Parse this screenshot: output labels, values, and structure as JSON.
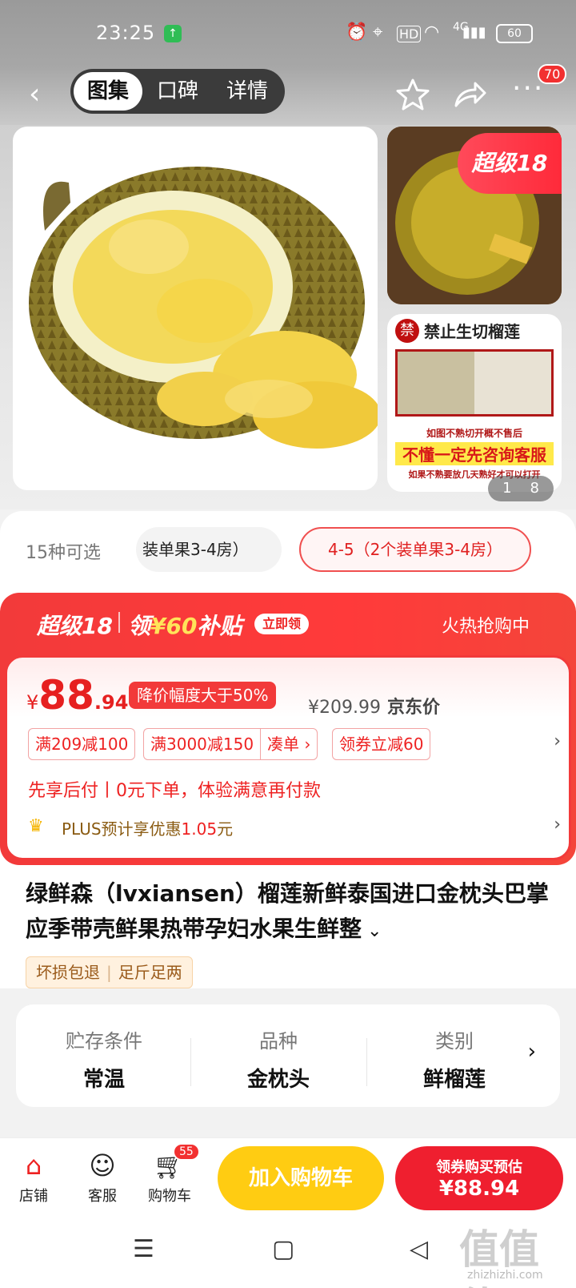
{
  "status_bar": {
    "time": "23:25",
    "network": "4G",
    "battery": "60"
  },
  "top_nav": {
    "tabs": [
      "图集",
      "口碑",
      "详情"
    ],
    "active_tab": "图集",
    "more_badge": "70"
  },
  "gallery": {
    "ribbon": "超级18",
    "counter_current": "1",
    "counter_total": "8",
    "banner_title": "禁止生切榴莲",
    "banner_mark": "禁",
    "banner_line1": "如图不熟切开概不售后",
    "banner_line2": "不懂一定先咨询客服",
    "banner_line3": "如果不熟要放几天熟好才可以打开"
  },
  "options": {
    "count_label": "15种可选",
    "chip_1": "装单果3-4房）",
    "chip_2": "4-5（2个装单果3-4房）"
  },
  "promo": {
    "brand": "超级18",
    "subsidy_prefix": "领",
    "subsidy_amount": "¥60",
    "subsidy_suffix": "补贴",
    "claim_btn": "立即领",
    "status": "火热抢购中"
  },
  "price": {
    "currency": "¥",
    "integer": "88",
    "decimal": ".94",
    "discount_tag": "降价幅度大于50%",
    "jd_price": "¥209.99",
    "jd_price_label": "京东价"
  },
  "coupons": [
    "满209减100",
    "满3000减150",
    "凑单 ›",
    "领券立减60"
  ],
  "pay_later": "先享后付丨0元下单，体验满意再付款",
  "plus": {
    "prefix": "PLUS预计享优惠",
    "value": "1.05",
    "suffix": "元"
  },
  "product": {
    "title": "绿鲜森（lvxiansen）榴莲新鲜泰国进口金枕头巴掌应季带壳鲜果热带孕妇水果生鲜整",
    "guarantee_1": "坏损包退",
    "guarantee_2": "足斤足两"
  },
  "specs": [
    {
      "key": "贮存条件",
      "value": "常温"
    },
    {
      "key": "品种",
      "value": "金枕头"
    },
    {
      "key": "类别",
      "value": "鲜榴莲"
    }
  ],
  "bottom_bar": {
    "shop": "店铺",
    "service": "客服",
    "cart": "购物车",
    "cart_badge": "55",
    "add_to_cart": "加入购物车",
    "buy_line1": "领券购买预估",
    "buy_line2": "¥88.94"
  },
  "watermark": {
    "text": "值",
    "site": "zhizhizhi.com"
  },
  "colors": {
    "accent": "#f23a3a",
    "cart_yellow": "#ffcc12",
    "buy_red": "#ef1f2f"
  }
}
